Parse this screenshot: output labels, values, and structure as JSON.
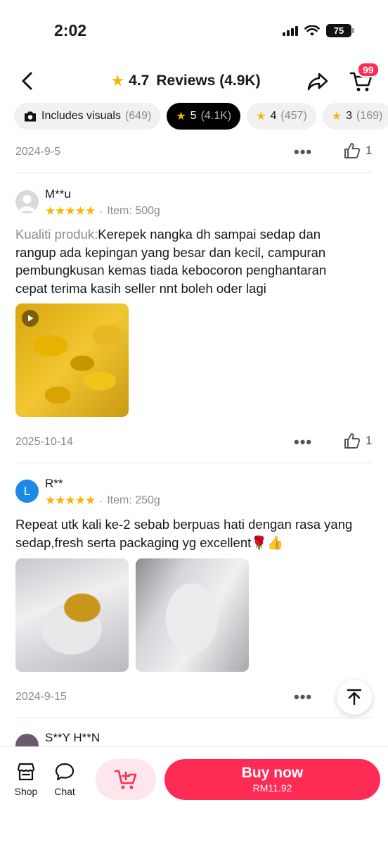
{
  "status": {
    "time": "2:02",
    "battery": "75"
  },
  "header": {
    "rating": "4.7",
    "title": "Reviews (4.9K)",
    "cart_badge": "99"
  },
  "filters": [
    {
      "label": "Includes visuals",
      "count": "(649)"
    },
    {
      "label": "5",
      "count": "(4.1K)"
    },
    {
      "label": "4",
      "count": "(457)"
    },
    {
      "label": "3",
      "count": "(169)"
    }
  ],
  "reviews": [
    {
      "date": "2024-9-5",
      "likes": "1"
    },
    {
      "name": "M**u",
      "stars": "★★★★★",
      "item": "Item: 500g",
      "label": "Kualiti produk:",
      "text": "Kerepek nangka dh sampai sedap dan rangup ada kepingan yang besar dan kecil, campuran pembungkusan kemas tiada kebocoron penghantaran cepat terima kasih seller nnt boleh oder lagi",
      "date": "2025-10-14",
      "likes": "1"
    },
    {
      "name": "R**",
      "avatar_letter": "L",
      "stars": "★★★★★",
      "item": "Item: 250g",
      "text": "Repeat utk kali ke-2 sebab berpuas hati dengan rasa yang sedap,fresh serta packaging yg excellent🌹👍",
      "date": "2024-9-15"
    },
    {
      "name": "S**Y H**N"
    }
  ],
  "bottom": {
    "shop": "Shop",
    "chat": "Chat",
    "buy_now": "Buy now",
    "price": "RM11.92"
  },
  "colors": {
    "accent": "#fe2c55",
    "star": "#f7b500"
  }
}
